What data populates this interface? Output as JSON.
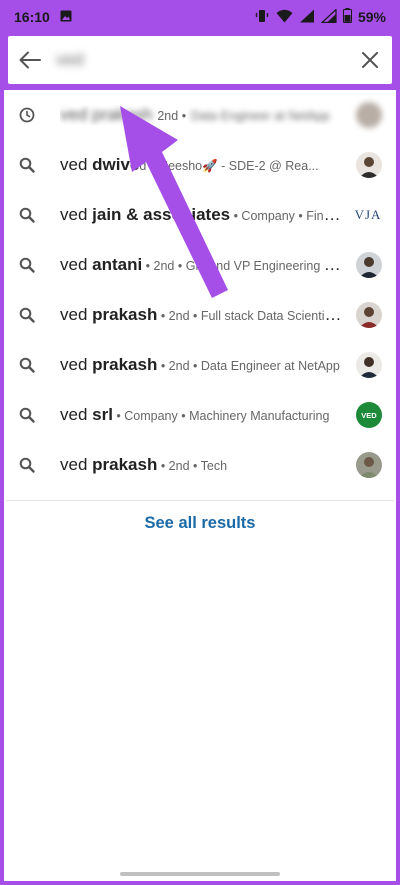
{
  "status_bar": {
    "time": "16:10",
    "battery": "59%"
  },
  "search": {
    "query": "ved"
  },
  "recent": {
    "name": "ved prakash",
    "degree": "2nd •",
    "headline": "Data Engineer at NetApp"
  },
  "results": [
    {
      "prefix": "ved ",
      "bold": "dwive",
      "meta": "d • Meesho🚀 - SDE-2 @ Rea...",
      "avatar": "person"
    },
    {
      "prefix": "ved ",
      "bold": "jain & associates",
      "meta": " • Company • Financi...",
      "avatar": "VJA"
    },
    {
      "prefix": "ved ",
      "bold": "antani",
      "meta": " • 2nd • GM and VP Engineering and...",
      "avatar": "person"
    },
    {
      "prefix": "ved ",
      "bold": "prakash",
      "meta": " • 2nd • Full stack Data Scientist |...",
      "avatar": "person"
    },
    {
      "prefix": "ved ",
      "bold": "prakash",
      "meta": " • 2nd • Data Engineer at NetApp",
      "avatar": "person"
    },
    {
      "prefix": "ved ",
      "bold": "srl",
      "meta": " • Company • Machinery Manufacturing",
      "avatar": "VED"
    },
    {
      "prefix": "ved ",
      "bold": "prakash",
      "meta": " • 2nd • Tech",
      "avatar": "person"
    }
  ],
  "see_all_label": "See all results",
  "colors": {
    "highlight": "#a64ee8",
    "link": "#1b6aa8",
    "ved_badge": "#1d8a3a"
  }
}
